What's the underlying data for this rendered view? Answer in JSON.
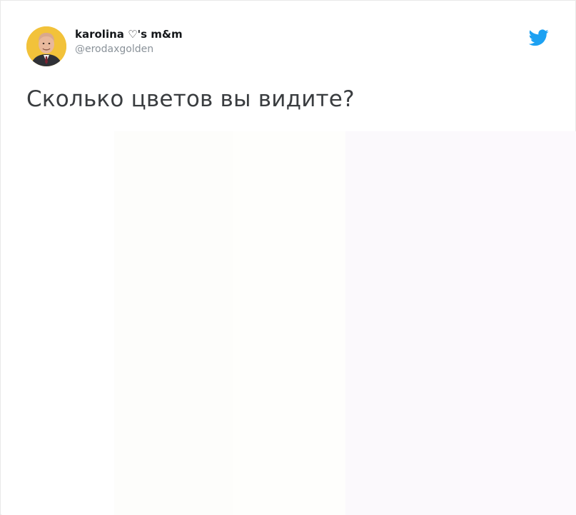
{
  "tweet": {
    "display_name": "karolina ♡'s m&m",
    "handle": "@erodaxgolden",
    "text": "Сколько цветов вы видите?",
    "avatar_icon": "avatar-photo-icon",
    "brand_icon": "twitter-bird-icon",
    "brand_color": "#1da1f2",
    "media": {
      "bands": [
        {
          "color": "#ffffff"
        },
        {
          "color": "#fdfdfb"
        },
        {
          "color": "#fefefc"
        },
        {
          "color": "#fbf9fc"
        },
        {
          "color": "#fcf9fd"
        }
      ]
    }
  }
}
